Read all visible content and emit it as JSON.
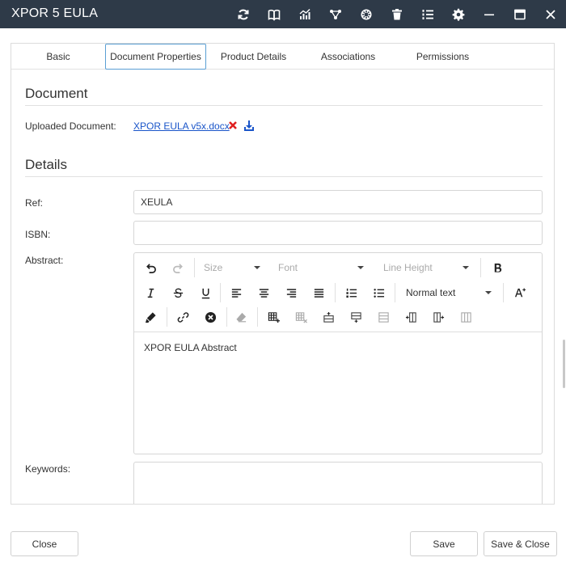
{
  "window": {
    "title": "XPOR 5 EULA"
  },
  "titlebar_icons": [
    "refresh-icon",
    "book-icon",
    "chart-icon",
    "workflow-icon",
    "cog-badge-icon",
    "trash-icon",
    "list-numbered-icon",
    "settings-icon",
    "minimize-icon",
    "maximize-icon",
    "close-icon"
  ],
  "tabs": [
    {
      "label": "Basic"
    },
    {
      "label": "Document Properties"
    },
    {
      "label": "Product Details"
    },
    {
      "label": "Associations"
    },
    {
      "label": "Permissions"
    }
  ],
  "active_tab": "Document Properties",
  "document_section": {
    "title": "Document",
    "uploaded_label": "Uploaded Document:",
    "file_name": "XPOR EULA v5x.docx"
  },
  "details_section": {
    "title": "Details",
    "ref_label": "Ref:",
    "ref_value": "XEULA",
    "isbn_label": "ISBN:",
    "isbn_value": "",
    "abstract_label": "Abstract:",
    "abstract_value": "XPOR EULA Abstract",
    "keywords_label": "Keywords:",
    "keywords_value": ""
  },
  "editor_toolbar": {
    "size_placeholder": "Size",
    "font_placeholder": "Font",
    "line_height_placeholder": "Line Height",
    "paragraph_style": "Normal text"
  },
  "footer": {
    "close_label": "Close",
    "save_label": "Save",
    "save_close_label": "Save & Close"
  },
  "colors": {
    "titlebar_bg": "#2e3a48",
    "link": "#1a55c9",
    "remove": "#e02020",
    "download": "#1a55c9",
    "active_tab_border": "#5a9fd4"
  }
}
